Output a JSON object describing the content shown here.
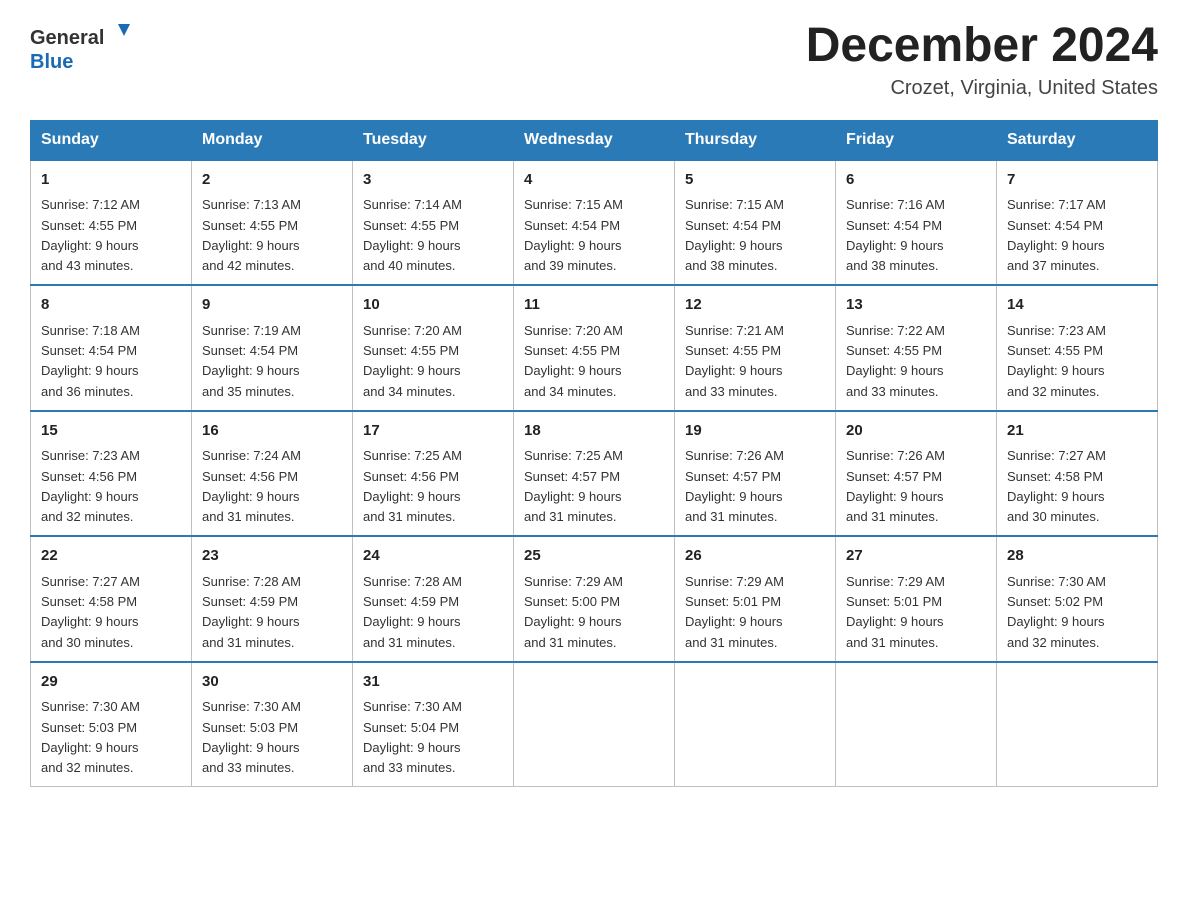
{
  "logo": {
    "text_general": "General",
    "text_blue": "Blue",
    "arrow_color": "#1a6bb5"
  },
  "header": {
    "month_year": "December 2024",
    "location": "Crozet, Virginia, United States"
  },
  "days_of_week": [
    "Sunday",
    "Monday",
    "Tuesday",
    "Wednesday",
    "Thursday",
    "Friday",
    "Saturday"
  ],
  "weeks": [
    [
      {
        "day": "1",
        "sunrise": "7:12 AM",
        "sunset": "4:55 PM",
        "daylight": "9 hours and 43 minutes."
      },
      {
        "day": "2",
        "sunrise": "7:13 AM",
        "sunset": "4:55 PM",
        "daylight": "9 hours and 42 minutes."
      },
      {
        "day": "3",
        "sunrise": "7:14 AM",
        "sunset": "4:55 PM",
        "daylight": "9 hours and 40 minutes."
      },
      {
        "day": "4",
        "sunrise": "7:15 AM",
        "sunset": "4:54 PM",
        "daylight": "9 hours and 39 minutes."
      },
      {
        "day": "5",
        "sunrise": "7:15 AM",
        "sunset": "4:54 PM",
        "daylight": "9 hours and 38 minutes."
      },
      {
        "day": "6",
        "sunrise": "7:16 AM",
        "sunset": "4:54 PM",
        "daylight": "9 hours and 38 minutes."
      },
      {
        "day": "7",
        "sunrise": "7:17 AM",
        "sunset": "4:54 PM",
        "daylight": "9 hours and 37 minutes."
      }
    ],
    [
      {
        "day": "8",
        "sunrise": "7:18 AM",
        "sunset": "4:54 PM",
        "daylight": "9 hours and 36 minutes."
      },
      {
        "day": "9",
        "sunrise": "7:19 AM",
        "sunset": "4:54 PM",
        "daylight": "9 hours and 35 minutes."
      },
      {
        "day": "10",
        "sunrise": "7:20 AM",
        "sunset": "4:55 PM",
        "daylight": "9 hours and 34 minutes."
      },
      {
        "day": "11",
        "sunrise": "7:20 AM",
        "sunset": "4:55 PM",
        "daylight": "9 hours and 34 minutes."
      },
      {
        "day": "12",
        "sunrise": "7:21 AM",
        "sunset": "4:55 PM",
        "daylight": "9 hours and 33 minutes."
      },
      {
        "day": "13",
        "sunrise": "7:22 AM",
        "sunset": "4:55 PM",
        "daylight": "9 hours and 33 minutes."
      },
      {
        "day": "14",
        "sunrise": "7:23 AM",
        "sunset": "4:55 PM",
        "daylight": "9 hours and 32 minutes."
      }
    ],
    [
      {
        "day": "15",
        "sunrise": "7:23 AM",
        "sunset": "4:56 PM",
        "daylight": "9 hours and 32 minutes."
      },
      {
        "day": "16",
        "sunrise": "7:24 AM",
        "sunset": "4:56 PM",
        "daylight": "9 hours and 31 minutes."
      },
      {
        "day": "17",
        "sunrise": "7:25 AM",
        "sunset": "4:56 PM",
        "daylight": "9 hours and 31 minutes."
      },
      {
        "day": "18",
        "sunrise": "7:25 AM",
        "sunset": "4:57 PM",
        "daylight": "9 hours and 31 minutes."
      },
      {
        "day": "19",
        "sunrise": "7:26 AM",
        "sunset": "4:57 PM",
        "daylight": "9 hours and 31 minutes."
      },
      {
        "day": "20",
        "sunrise": "7:26 AM",
        "sunset": "4:57 PM",
        "daylight": "9 hours and 31 minutes."
      },
      {
        "day": "21",
        "sunrise": "7:27 AM",
        "sunset": "4:58 PM",
        "daylight": "9 hours and 30 minutes."
      }
    ],
    [
      {
        "day": "22",
        "sunrise": "7:27 AM",
        "sunset": "4:58 PM",
        "daylight": "9 hours and 30 minutes."
      },
      {
        "day": "23",
        "sunrise": "7:28 AM",
        "sunset": "4:59 PM",
        "daylight": "9 hours and 31 minutes."
      },
      {
        "day": "24",
        "sunrise": "7:28 AM",
        "sunset": "4:59 PM",
        "daylight": "9 hours and 31 minutes."
      },
      {
        "day": "25",
        "sunrise": "7:29 AM",
        "sunset": "5:00 PM",
        "daylight": "9 hours and 31 minutes."
      },
      {
        "day": "26",
        "sunrise": "7:29 AM",
        "sunset": "5:01 PM",
        "daylight": "9 hours and 31 minutes."
      },
      {
        "day": "27",
        "sunrise": "7:29 AM",
        "sunset": "5:01 PM",
        "daylight": "9 hours and 31 minutes."
      },
      {
        "day": "28",
        "sunrise": "7:30 AM",
        "sunset": "5:02 PM",
        "daylight": "9 hours and 32 minutes."
      }
    ],
    [
      {
        "day": "29",
        "sunrise": "7:30 AM",
        "sunset": "5:03 PM",
        "daylight": "9 hours and 32 minutes."
      },
      {
        "day": "30",
        "sunrise": "7:30 AM",
        "sunset": "5:03 PM",
        "daylight": "9 hours and 33 minutes."
      },
      {
        "day": "31",
        "sunrise": "7:30 AM",
        "sunset": "5:04 PM",
        "daylight": "9 hours and 33 minutes."
      },
      null,
      null,
      null,
      null
    ]
  ],
  "labels": {
    "sunrise": "Sunrise:",
    "sunset": "Sunset:",
    "daylight": "Daylight:"
  }
}
